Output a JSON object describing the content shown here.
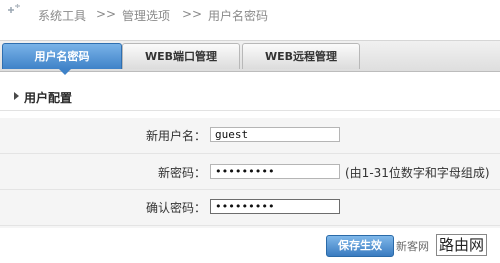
{
  "breadcrumb": {
    "items": [
      "系统工具",
      ">>",
      "管理选项",
      ">>",
      "用户名密码"
    ]
  },
  "tabs": [
    {
      "label": "用户名密码",
      "active": true
    },
    {
      "label": "WEB端口管理",
      "active": false
    },
    {
      "label": "WEB远程管理",
      "active": false
    }
  ],
  "section": {
    "title": "用户配置"
  },
  "form": {
    "username_label": "新用户名：",
    "username_value": "guest",
    "password_label": "新密码：",
    "password_value": "•••••••••",
    "password_hint": "(由1-31位数字和字母组成)",
    "confirm_label": "确认密码：",
    "confirm_value": "•••••••••"
  },
  "actions": {
    "save_label": "保存生效"
  },
  "watermark": {
    "text": "新客网",
    "box": "路由网"
  },
  "colors": {
    "accent": "#3f82c8",
    "tab_bg": "#e6e6e6",
    "panel_bg": "#f5f5f5"
  }
}
